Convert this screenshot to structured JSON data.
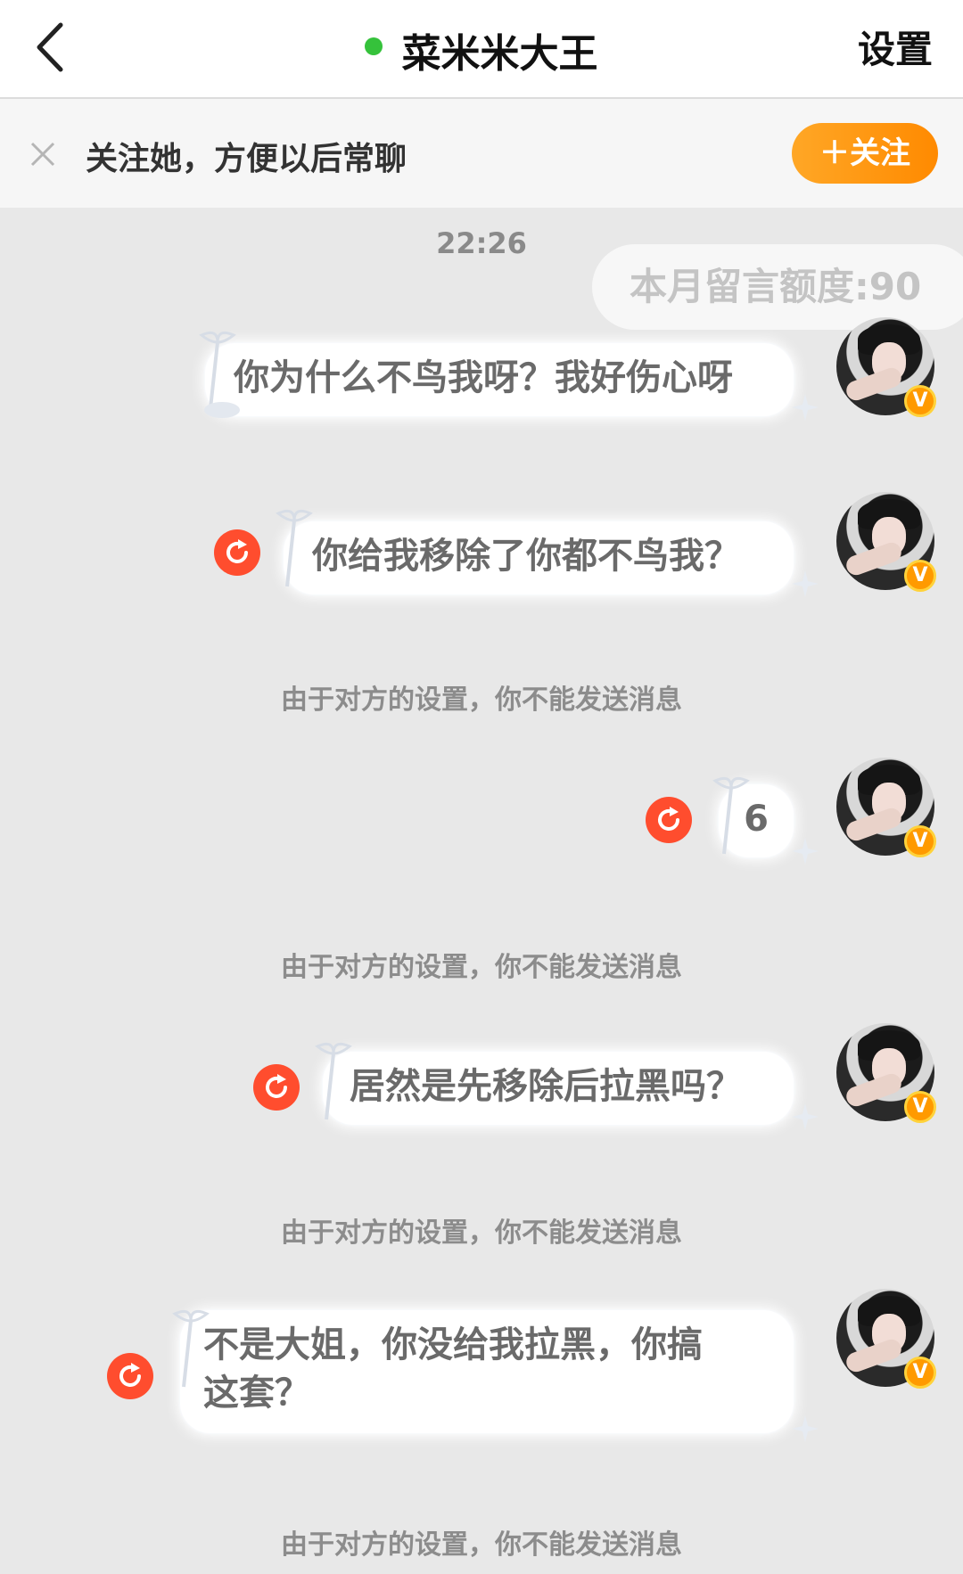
{
  "header": {
    "title": "菜米米大王",
    "settings_label": "设置"
  },
  "follow_bar": {
    "text": "关注她，方便以后常聊",
    "button_label": "＋关注"
  },
  "chat": {
    "timestamp": "22:26",
    "quota_text": "本月留言额度:90",
    "messages": [
      {
        "text": "你为什么不鸟我呀？我好伤心呀",
        "failed": false
      },
      {
        "text": "你给我移除了你都不鸟我？",
        "failed": true
      },
      {
        "text": "6",
        "failed": true
      },
      {
        "text": "居然是先移除后拉黑吗？",
        "failed": true
      },
      {
        "text": "不是大姐，你没给我拉黑，你搞这套？",
        "failed": true
      }
    ],
    "system_note": "由于对方的设置，你不能发送消息"
  },
  "colors": {
    "accent_orange": "#ff8a00",
    "online_green": "#35c23b",
    "resend_red": "#ff4d2e",
    "verified_badge": "#ff9a00"
  }
}
